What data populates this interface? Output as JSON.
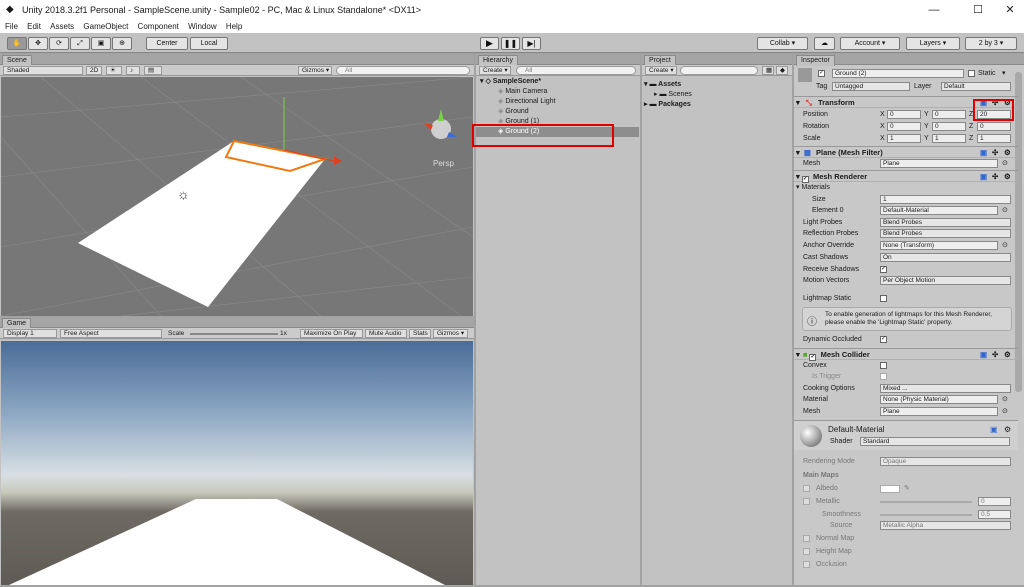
{
  "window": {
    "title": "Unity 2018.3.2f1 Personal - SampleScene.unity - Sample02 - PC, Mac & Linux Standalone* <DX11>",
    "minimize": "—",
    "maximize": "☐",
    "close": "✕"
  },
  "menu": [
    "File",
    "Edit",
    "Assets",
    "GameObject",
    "Component",
    "Window",
    "Help"
  ],
  "toolbar": {
    "center": "Center",
    "local": "Local",
    "collab": "Collab ▾",
    "account": "Account ▾",
    "layers": "Layers ▾",
    "layout": "2 by 3 ▾"
  },
  "scene": {
    "tab": "Scene",
    "shading": "Shaded",
    "mode2d": "2D",
    "gizmos": "Gizmos ▾",
    "search": "All",
    "persp": "Persp"
  },
  "game": {
    "tab": "Game",
    "display": "Display 1",
    "aspect": "Free Aspect",
    "scale_label": "Scale",
    "scale_value": "1x",
    "maximize": "Maximize On Play",
    "mute": "Mute Audio",
    "stats": "Stats",
    "gizmos": "Gizmos ▾"
  },
  "hierarchy": {
    "tab": "Hierarchy",
    "create": "Create ▾",
    "search": "All",
    "scene": "SampleScene*",
    "items": [
      "Main Camera",
      "Directional Light",
      "Ground",
      "Ground (1)",
      "Ground (2)"
    ]
  },
  "project": {
    "tab": "Project",
    "create": "Create ▾",
    "items": [
      "Assets",
      "Scenes",
      "Packages"
    ]
  },
  "inspector": {
    "tab": "Inspector",
    "object_name": "Ground (2)",
    "static": "Static",
    "tag_label": "Tag",
    "tag": "Untagged",
    "layer_label": "Layer",
    "layer": "Default",
    "transform": {
      "title": "Transform",
      "rows": [
        {
          "label": "Position",
          "x": "0",
          "y": "0",
          "z": "20"
        },
        {
          "label": "Rotation",
          "x": "0",
          "y": "0",
          "z": "0"
        },
        {
          "label": "Scale",
          "x": "1",
          "y": "1",
          "z": "1"
        }
      ],
      "axis": [
        "X",
        "Y",
        "Z"
      ]
    },
    "mesh_filter": {
      "title": "Plane (Mesh Filter)",
      "mesh_label": "Mesh",
      "mesh": "Plane"
    },
    "mesh_renderer": {
      "title": "Mesh Renderer",
      "materials": "Materials",
      "size_label": "Size",
      "size": "1",
      "element_label": "Element 0",
      "element": "Default-Material",
      "light_probes_label": "Light Probes",
      "light_probes": "Blend Probes",
      "reflection_label": "Reflection Probes",
      "reflection": "Blend Probes",
      "anchor_label": "Anchor Override",
      "anchor": "None (Transform)",
      "cast_label": "Cast Shadows",
      "cast": "On",
      "receive_label": "Receive Shadows",
      "motion_label": "Motion Vectors",
      "motion": "Per Object Motion",
      "lightmap_label": "Lightmap Static",
      "info": "To enable generation of lightmaps for this Mesh Renderer, please enable the 'Lightmap Static' property.",
      "dynamic_label": "Dynamic Occluded"
    },
    "mesh_collider": {
      "title": "Mesh Collider",
      "convex": "Convex",
      "trigger": "Is Trigger",
      "cooking_label": "Cooking Options",
      "cooking": "Mixed ...",
      "material_label": "Material",
      "material": "None (Physic Material)",
      "mesh_label": "Mesh",
      "mesh": "Plane"
    },
    "material": {
      "name": "Default-Material",
      "shader_label": "Shader",
      "shader": "Standard",
      "rendering_label": "Rendering Mode",
      "rendering": "Opaque",
      "main_maps": "Main Maps",
      "albedo": "Albedo",
      "metallic": "Metallic",
      "metallic_value": "0",
      "smoothness": "Smoothness",
      "smoothness_value": "0.5",
      "source_label": "Source",
      "source": "Metallic Alpha",
      "normal": "Normal Map",
      "height": "Height Map",
      "occlusion": "Occlusion"
    }
  },
  "colors": {
    "highlight": "#e00000",
    "selection": "#8e8e8e",
    "orange": "#f07a10"
  }
}
